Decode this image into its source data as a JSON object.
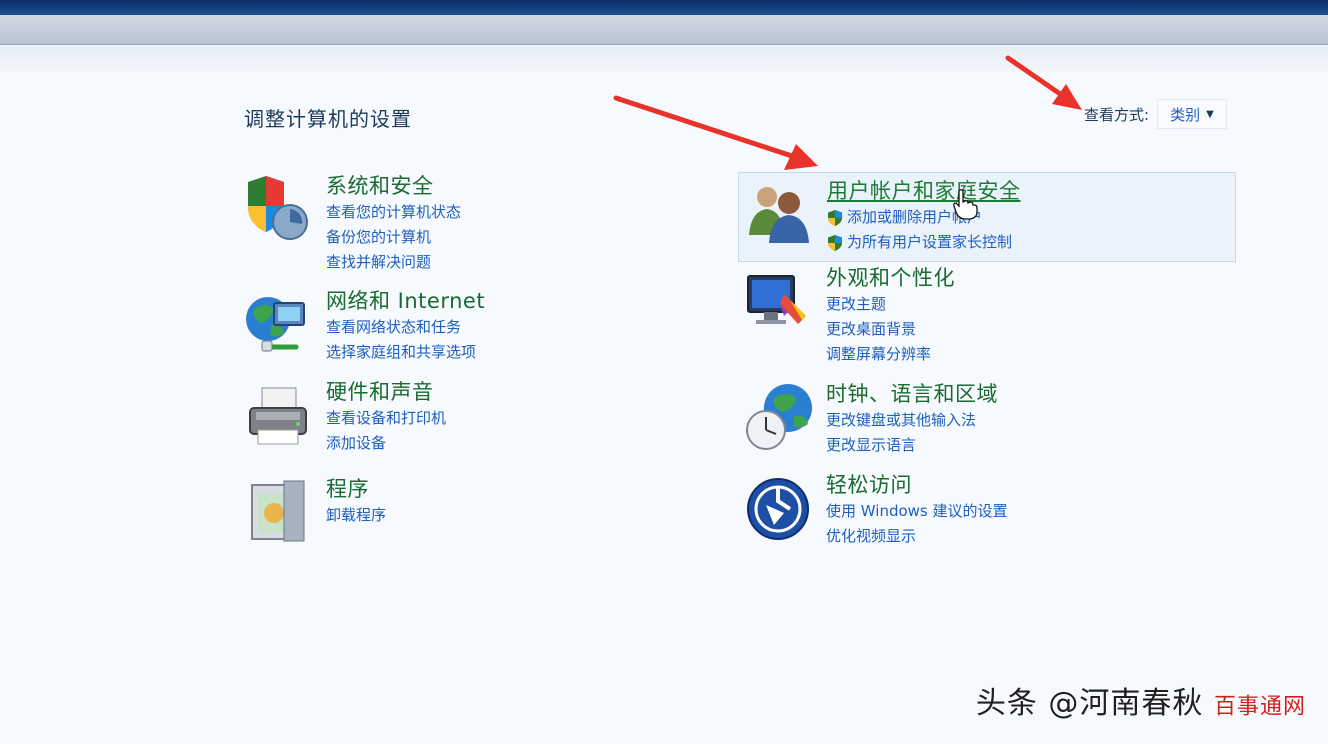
{
  "page": {
    "title": "调整计算机的设置",
    "view_by_label": "查看方式:",
    "view_by_value": "类别"
  },
  "categories": [
    {
      "id": "system-security",
      "title": "系统和安全",
      "icon": "shield-icon",
      "links": [
        "查看您的计算机状态",
        "备份您的计算机",
        "查找并解决问题"
      ]
    },
    {
      "id": "network-internet",
      "title": "网络和 Internet",
      "icon": "network-globe-icon",
      "links": [
        "查看网络状态和任务",
        "选择家庭组和共享选项"
      ]
    },
    {
      "id": "hardware-sound",
      "title": "硬件和声音",
      "icon": "printer-icon",
      "links": [
        "查看设备和打印机",
        "添加设备"
      ]
    },
    {
      "id": "programs",
      "title": "程序",
      "icon": "programs-box-icon",
      "links": [
        "卸载程序"
      ]
    },
    {
      "id": "user-accounts",
      "title": "用户帐户和家庭安全",
      "icon": "users-icon",
      "links": [
        "添加或删除用户帐户",
        "为所有用户设置家长控制"
      ]
    },
    {
      "id": "appearance",
      "title": "外观和个性化",
      "icon": "monitor-palette-icon",
      "links": [
        "更改主题",
        "更改桌面背景",
        "调整屏幕分辨率"
      ]
    },
    {
      "id": "clock-language",
      "title": "时钟、语言和区域",
      "icon": "clock-globe-icon",
      "links": [
        "更改键盘或其他输入法",
        "更改显示语言"
      ]
    },
    {
      "id": "ease-of-access",
      "title": "轻松访问",
      "icon": "ease-of-access-icon",
      "links": [
        "使用 Windows 建议的设置",
        "优化视频显示"
      ]
    }
  ],
  "watermark": {
    "main": "头条 @河南春秋",
    "overlay": "百事通网"
  },
  "colors": {
    "accent_link": "#1f5fbf",
    "category_title": "#1a6b2f",
    "annotation_arrow": "#e8322a"
  }
}
